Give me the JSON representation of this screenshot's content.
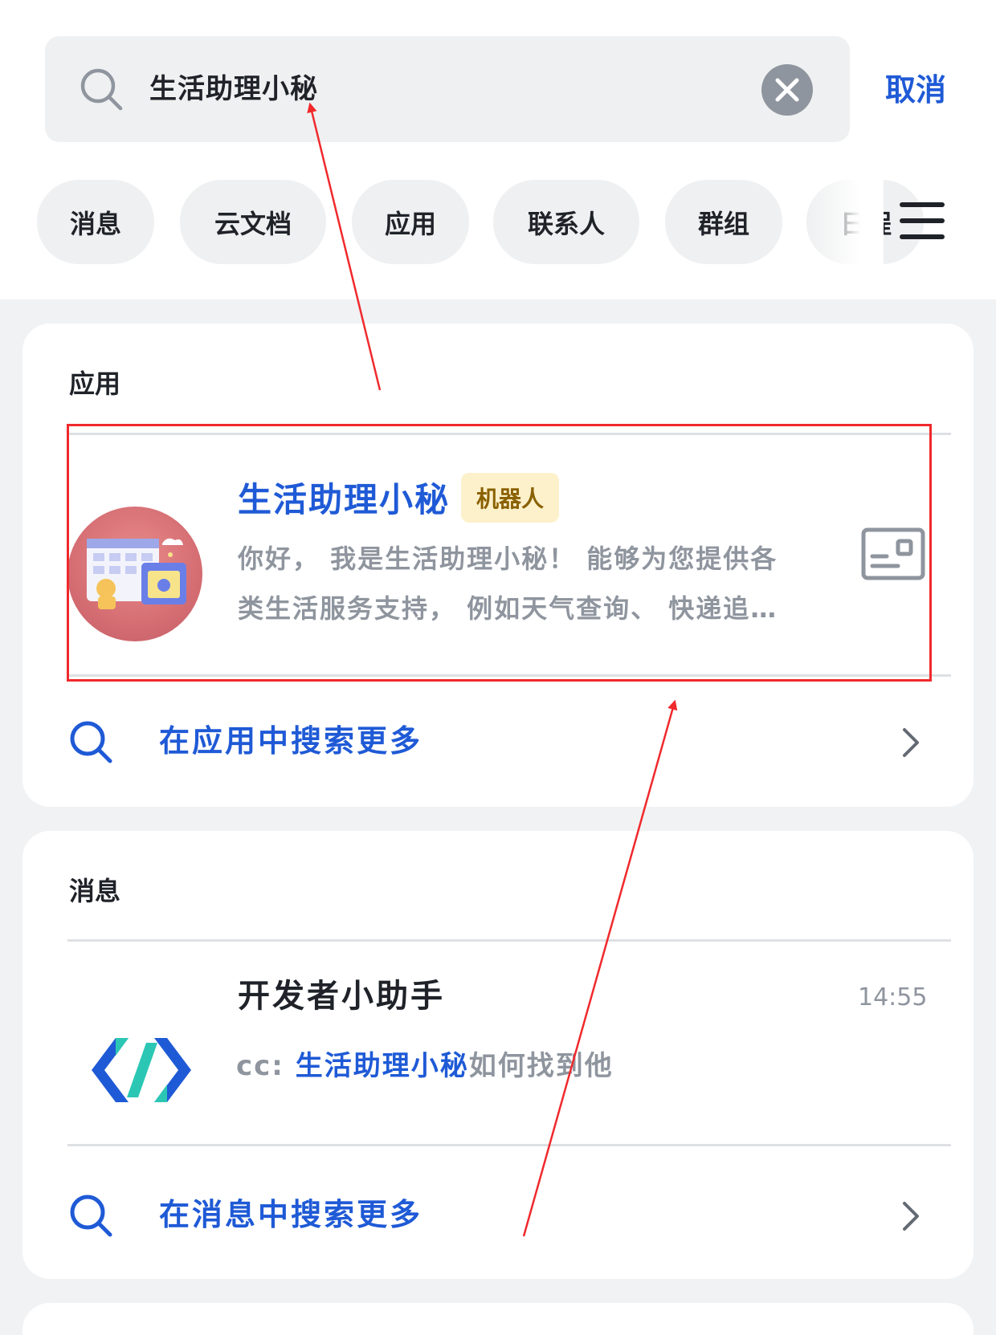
{
  "search": {
    "query": "生活助理小秘",
    "cancel_label": "取消"
  },
  "filters": [
    {
      "label": "消息"
    },
    {
      "label": "云文档"
    },
    {
      "label": "应用"
    },
    {
      "label": "联系人"
    },
    {
      "label": "群组"
    },
    {
      "label": "日程"
    }
  ],
  "apps_section": {
    "title": "应用",
    "result": {
      "name": "生活助理小秘",
      "badge": "机器人",
      "desc_line1": "你好， 我是生活助理小秘！ 能够为您提供各",
      "desc_line2": "类生活服务支持， 例如天气查询、 快递追…"
    },
    "search_more": "在应用中搜索更多"
  },
  "messages_section": {
    "title": "消息",
    "result": {
      "title": "开发者小助手",
      "time": "14:55",
      "preview_prefix": "cc: ",
      "preview_highlight": "生活助理小秘",
      "preview_suffix": "如何找到他"
    },
    "search_more": "在消息中搜索更多"
  },
  "colors": {
    "accent": "#1f5ad6",
    "annotation": "#f0292c",
    "badge_bg": "#fdf1cc",
    "badge_text": "#8a6100"
  }
}
